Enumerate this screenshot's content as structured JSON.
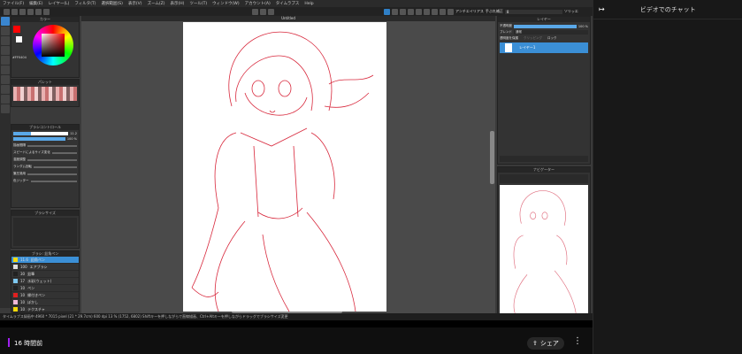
{
  "app": {
    "menu": [
      "ファイル(F)",
      "編集(E)",
      "レイヤー(L)",
      "フィルタ(T)",
      "選択範囲(S)",
      "表示(V)",
      "ズーム(Z)",
      "表示(H)",
      "ツール(T)",
      "ウィンドウ(W)",
      "アカウント(A)",
      "タイムラプス",
      "Help"
    ],
    "toolbar": {
      "antialias_label": "アンチエイリアス",
      "correction_label": "手ぶれ補正",
      "correction_value": "8",
      "snap_label": "ソリッエ"
    },
    "canvas_tab": "Untitled",
    "panels": {
      "color": {
        "title": "カラー",
        "hex": "#FF0404"
      },
      "palette": {
        "title": "パレット"
      },
      "brush_control": {
        "title": "ブラシコントロール",
        "size": "11.2",
        "opacity": "100 %",
        "rows": [
          "描画間隔",
          "スピードによるサイズ変化",
          "濃度調整",
          "ランダム回転",
          "筆圧適用",
          "色ジッター"
        ]
      },
      "brush_size": {
        "title": "ブラシサイズ"
      },
      "brush_list": {
        "title": "ブラシ: 鉛角ペン",
        "items": [
          {
            "size": "11.6",
            "name": "鉛角ペン",
            "color": "#f5d90a",
            "selected": true
          },
          {
            "size": "100",
            "name": "エアブラシ",
            "color": "#dddddd"
          },
          {
            "size": "30",
            "name": "鉛筆",
            "color": "#222222"
          },
          {
            "size": "17",
            "name": "水彩(ウェット)",
            "color": "#7ec8f0"
          },
          {
            "size": "10",
            "name": "ペン",
            "color": "#222222"
          },
          {
            "size": "10",
            "name": "縁付きペン",
            "color": "#e02020"
          },
          {
            "size": "10",
            "name": "ぼかし",
            "color": "#f0b8d8"
          },
          {
            "size": "10",
            "name": "テクスチャ",
            "color": "#f5d90a"
          }
        ]
      }
    },
    "layer": {
      "title": "レイヤー",
      "opacity_label": "不透明度",
      "opacity_value": "100 %",
      "blend_label": "ブレンド",
      "blend_value": "通常",
      "protect_label": "透明度を保護",
      "clipping_label": "クリッピング",
      "lock_label": "ロック",
      "layers": [
        {
          "name": "レイヤー1"
        }
      ]
    },
    "navigator": {
      "title": "ナビゲーター"
    },
    "status": "タイムラプス録画中  4960 * 7015 pixel  (21 * 29.7cm)  600 dpi  13 %  (1752, 6802)  Shiftキーを押しながらで直線描画、Ctrl+Altキーを押しながらドラッグでブラシサイズ変更"
  },
  "video": {
    "time_ago": "16 時間前",
    "share_label": "シェア"
  },
  "chat": {
    "title": "ビデオでのチャット"
  },
  "colors": {
    "accent": "#3b8fd6",
    "line": "#d8283c",
    "live_bar": "#a020f0"
  }
}
